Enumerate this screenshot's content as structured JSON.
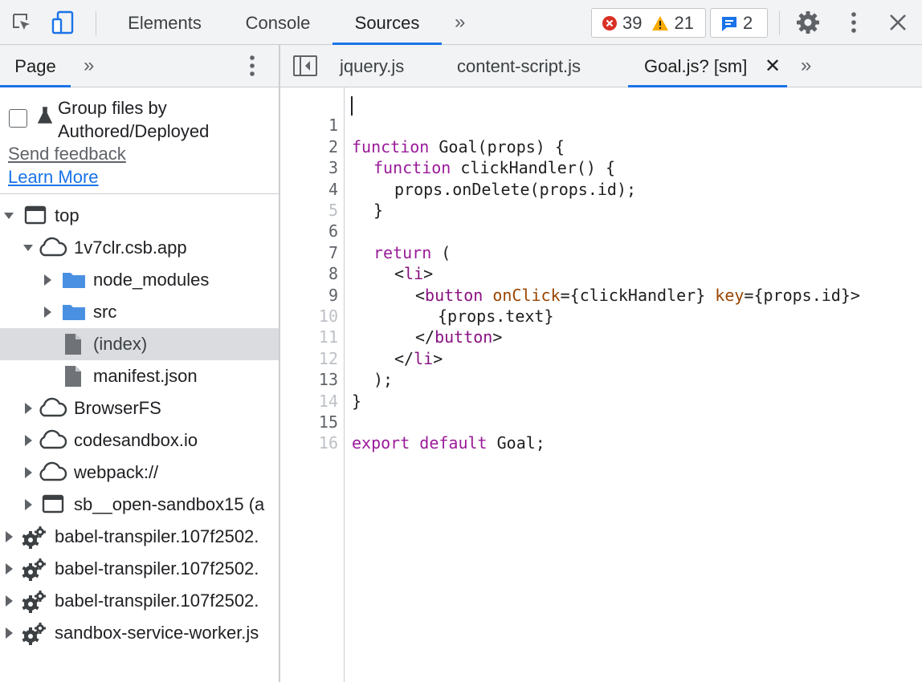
{
  "toolbar": {
    "inspect_icon": "inspect-element-icon",
    "device_icon": "device-toolbar-icon",
    "tabs": [
      {
        "label": "Elements"
      },
      {
        "label": "Console"
      },
      {
        "label": "Sources"
      }
    ],
    "more_tabs": "»",
    "errors": "39",
    "warnings": "21",
    "messages": "2",
    "colors": {
      "accent": "#1a73e8",
      "error": "#d93025",
      "warning": "#f9ab00",
      "message": "#1a73e8"
    }
  },
  "navigator": {
    "tab": "Page",
    "more": "»",
    "group_label": "Group files by Authored/Deployed",
    "send_feedback": "Send feedback",
    "learn_more": "Learn More",
    "tree": [
      {
        "label": "top"
      },
      {
        "label": "1v7clr.csb.app"
      },
      {
        "label": "node_modules"
      },
      {
        "label": "src"
      },
      {
        "label": "(index)"
      },
      {
        "label": "manifest.json"
      },
      {
        "label": "BrowserFS"
      },
      {
        "label": "codesandbox.io"
      },
      {
        "label": "webpack://"
      },
      {
        "label": "sb__open-sandbox15 (a"
      },
      {
        "label": "babel-transpiler.107f2502."
      },
      {
        "label": "babel-transpiler.107f2502."
      },
      {
        "label": "babel-transpiler.107f2502."
      },
      {
        "label": "sandbox-service-worker.js"
      }
    ]
  },
  "editor": {
    "file_tabs": [
      {
        "label": "jquery.js"
      },
      {
        "label": "content-script.js"
      },
      {
        "label": "Goal.js? [sm]"
      }
    ],
    "more": "»",
    "close": "✕",
    "lines": [
      {
        "num": "1"
      },
      {
        "num": "2"
      },
      {
        "num": "3"
      },
      {
        "num": "4"
      },
      {
        "num": "5"
      },
      {
        "num": "6"
      },
      {
        "num": "7"
      },
      {
        "num": "8"
      },
      {
        "num": "9"
      },
      {
        "num": "10"
      },
      {
        "num": "11"
      },
      {
        "num": "12"
      },
      {
        "num": "13"
      },
      {
        "num": "14"
      },
      {
        "num": "15"
      },
      {
        "num": "16"
      }
    ],
    "tokens": {
      "l1_kw": "function",
      "l1_rest": " Goal(props) {",
      "l2_kw": "function",
      "l2_rest": " clickHandler() {",
      "l3": "props.onDelete(props.id);",
      "l4": "}",
      "l6_kw": "return",
      "l6_rest": " (",
      "l7_open": "<",
      "l7_tag": "li",
      "l7_close": ">",
      "l8_open": "<",
      "l8_tag": "button",
      "l8_attr1": "onClick",
      "l8_val1": "={clickHandler} ",
      "l8_attr2": "key",
      "l8_val2": "={props.id}>",
      "l9": "{props.text}",
      "l10_open": "</",
      "l10_tag": "button",
      "l10_close": ">",
      "l11_open": "</",
      "l11_tag": "li",
      "l11_close": ">",
      "l12": ");",
      "l13": "}",
      "l15_kw1": "export",
      "l15_kw2": "default",
      "l15_rest": " Goal;"
    }
  }
}
